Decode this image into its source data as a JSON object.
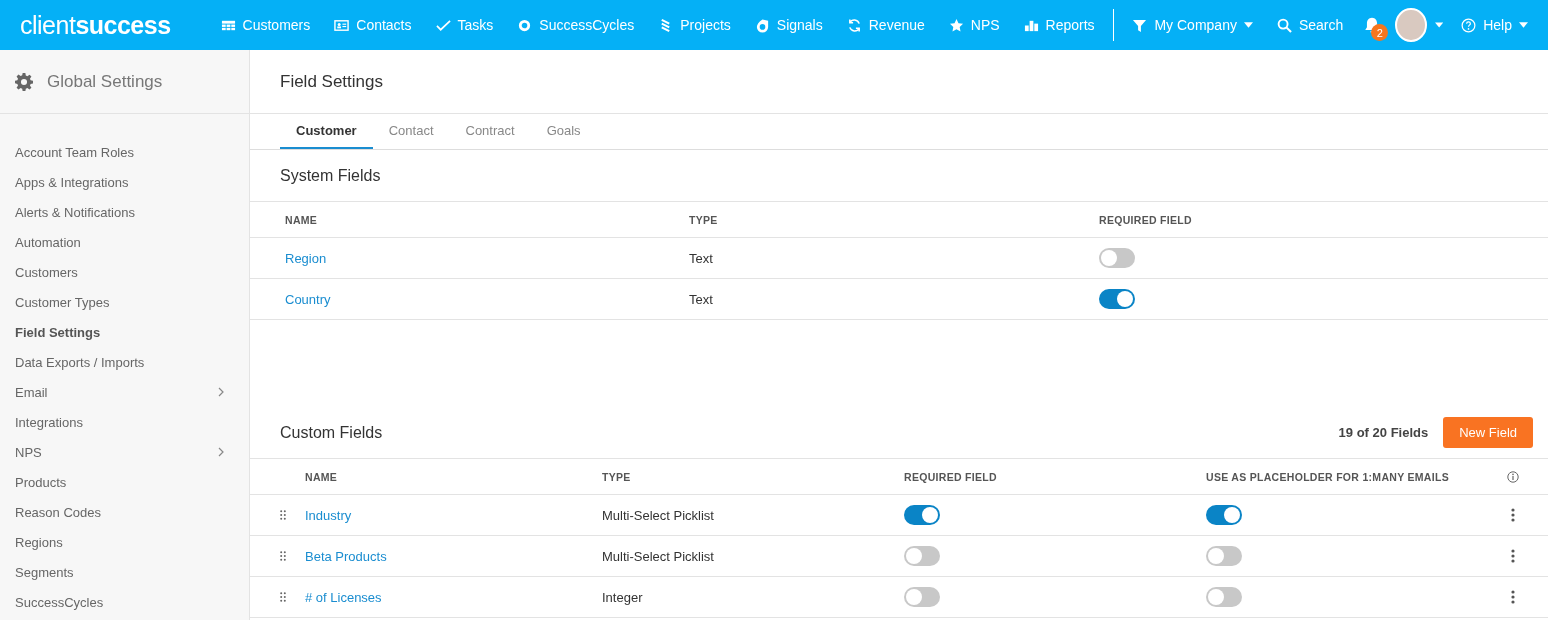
{
  "top_bar": {
    "logo": "client**success**",
    "nav": [
      {
        "label": "Customers"
      },
      {
        "label": "Contacts"
      },
      {
        "label": "Tasks"
      },
      {
        "label": "SuccessCycles"
      },
      {
        "label": "Projects"
      },
      {
        "label": "Signals"
      },
      {
        "label": "Revenue"
      },
      {
        "label": "NPS"
      },
      {
        "label": "Reports"
      }
    ],
    "company_filter": "My Company",
    "search": "Search",
    "notification_count": "2",
    "help": "Help"
  },
  "sidebar": {
    "title": "Global Settings",
    "items": [
      {
        "label": "Account Team Roles",
        "selected": false,
        "has_submenu": false
      },
      {
        "label": "Apps & Integrations",
        "selected": false,
        "has_submenu": false
      },
      {
        "label": "Alerts & Notifications",
        "selected": false,
        "has_submenu": false
      },
      {
        "label": "Automation",
        "selected": false,
        "has_submenu": false
      },
      {
        "label": "Customers",
        "selected": false,
        "has_submenu": false
      },
      {
        "label": "Customer Types",
        "selected": false,
        "has_submenu": false
      },
      {
        "label": "Field Settings",
        "selected": true,
        "has_submenu": false
      },
      {
        "label": "Data Exports / Imports",
        "selected": false,
        "has_submenu": false
      },
      {
        "label": "Email",
        "selected": false,
        "has_submenu": true
      },
      {
        "label": "Integrations",
        "selected": false,
        "has_submenu": false
      },
      {
        "label": "NPS",
        "selected": false,
        "has_submenu": true
      },
      {
        "label": "Products",
        "selected": false,
        "has_submenu": false
      },
      {
        "label": "Reason Codes",
        "selected": false,
        "has_submenu": false
      },
      {
        "label": "Regions",
        "selected": false,
        "has_submenu": false
      },
      {
        "label": "Segments",
        "selected": false,
        "has_submenu": false
      },
      {
        "label": "SuccessCycles",
        "selected": false,
        "has_submenu": false
      }
    ]
  },
  "page_title": "Field Settings",
  "tabs": [
    {
      "label": "Customer",
      "selected": true
    },
    {
      "label": "Contact",
      "selected": false
    },
    {
      "label": "Contract",
      "selected": false
    },
    {
      "label": "Goals",
      "selected": false
    }
  ],
  "system_fields": {
    "title": "System Fields",
    "columns": [
      "NAME",
      "TYPE",
      "REQUIRED FIELD"
    ],
    "rows": [
      {
        "name": "Region",
        "type": "Text",
        "required": false
      },
      {
        "name": "Country",
        "type": "Text",
        "required": true
      }
    ]
  },
  "custom_fields": {
    "title": "Custom Fields",
    "count": "19 of 20 Fields",
    "new_button": "New Field",
    "columns": [
      "NAME",
      "TYPE",
      "REQUIRED FIELD",
      "USE AS PLACEHOLDER FOR 1:MANY EMAILS"
    ],
    "rows": [
      {
        "name": "Industry",
        "type": "Multi-Select Picklist",
        "required": true,
        "placeholder": true
      },
      {
        "name": "Beta Products",
        "type": "Multi-Select Picklist",
        "required": false,
        "placeholder": false
      },
      {
        "name": "# of Licenses",
        "type": "Integer",
        "required": false,
        "placeholder": false
      }
    ]
  }
}
